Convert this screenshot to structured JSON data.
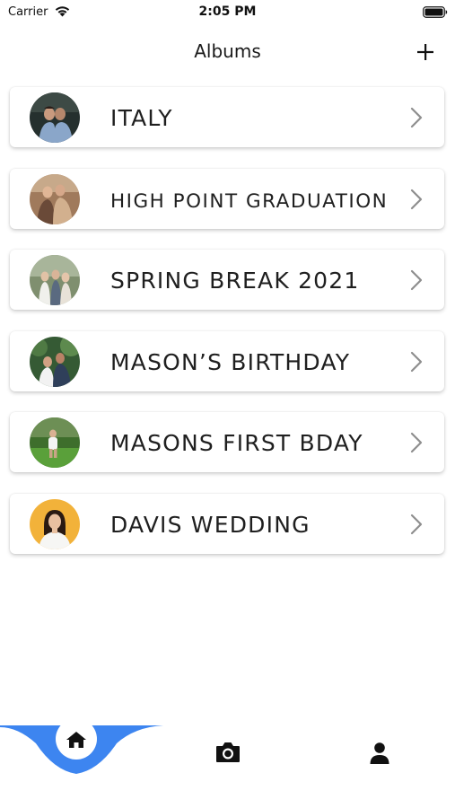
{
  "status_bar": {
    "carrier": "Carrier",
    "time": "2:05 PM"
  },
  "nav": {
    "title": "Albums",
    "add_icon": "plus-icon"
  },
  "albums": [
    {
      "title": "ITALY",
      "avatar_bg": "#2b3a36"
    },
    {
      "title": "HIGH POINT GRADUATION",
      "avatar_bg": "#8a6a4f"
    },
    {
      "title": "SPRING BREAK 2021",
      "avatar_bg": "#6e7f62"
    },
    {
      "title": "MASON’S BIRTHDAY",
      "avatar_bg": "#3c5a3a"
    },
    {
      "title": "MASONS FIRST BDAY",
      "avatar_bg": "#4f8a32"
    },
    {
      "title": "DAVIS WEDDING",
      "avatar_bg": "#f0b43c"
    }
  ],
  "tab_bar": {
    "accent": "#3d85f0",
    "tabs": [
      "home-icon",
      "camera-icon",
      "person-icon"
    ]
  }
}
